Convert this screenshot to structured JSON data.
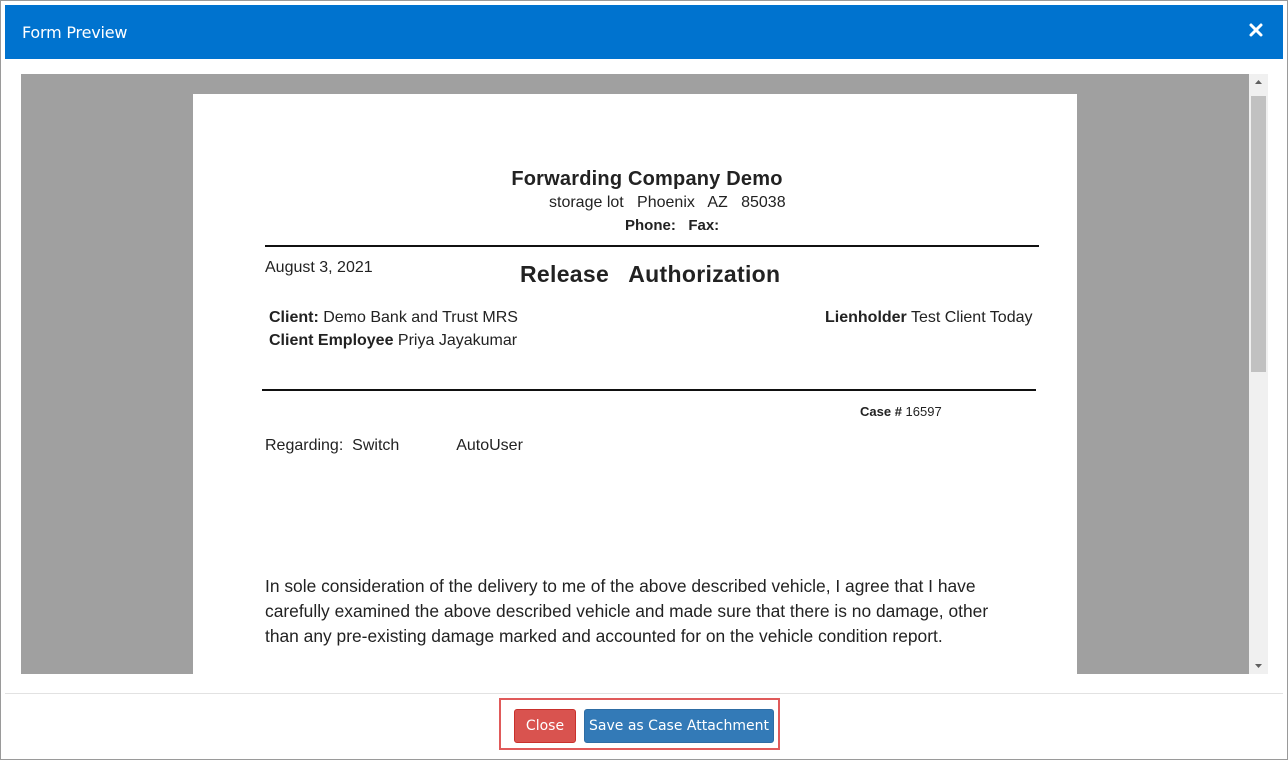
{
  "dialog": {
    "title": "Form Preview"
  },
  "document": {
    "company_name": "Forwarding Company Demo",
    "address": "storage lot   Phoenix   AZ   85038",
    "phone_line": "Phone:   Fax:",
    "date": "August 3, 2021",
    "doc_title": "Release   Authorization",
    "client_label": "Client:",
    "client_value": " Demo Bank and Trust MRS",
    "client_employee_label": "Client Employee",
    "client_employee_value": " Priya Jayakumar",
    "lienholder_label": "Lienholder",
    "lienholder_value": " Test Client Today",
    "case_label": "Case #",
    "case_value": " 16597",
    "regarding": "Regarding:  Switch             AutoUser",
    "body": "In sole consideration of the delivery to me of the above described vehicle, I agree that I have carefully examined the above described vehicle  and made sure that there is no damage, other than any pre-existing damage marked and accounted for on the vehicle condition report."
  },
  "footer": {
    "close_label": "Close",
    "save_label": "Save as Case Attachment"
  },
  "colors": {
    "header": "#0073cf",
    "close_button": "#d9534f",
    "save_button": "#337ab7",
    "highlight_frame": "#e05a5a",
    "viewer_background": "#a0a0a0"
  },
  "icons": {
    "close": "close-icon",
    "scroll_up": "chevron-up-icon",
    "scroll_down": "chevron-down-icon"
  }
}
